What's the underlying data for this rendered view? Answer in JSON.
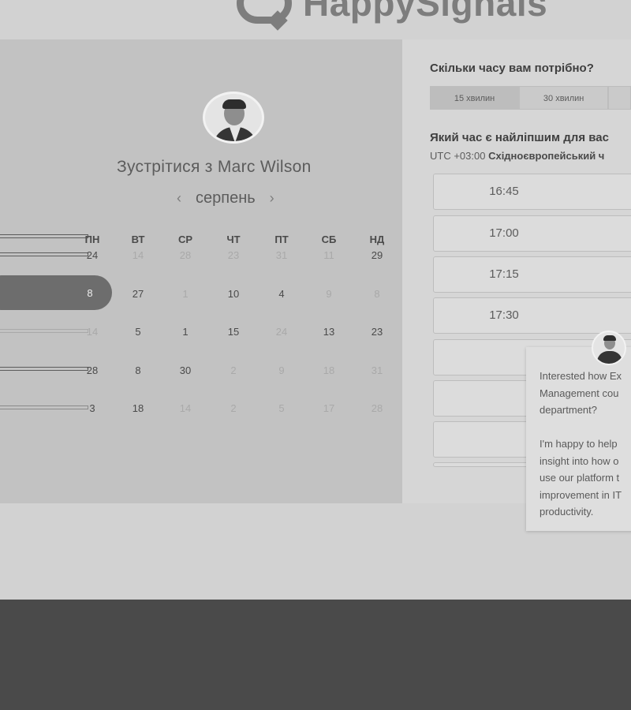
{
  "brand": {
    "logo_text": "HappySignals"
  },
  "calendar": {
    "meet_title": "Зустрітися з Marc Wilson",
    "month": "серпень",
    "prev_arrow": "‹",
    "next_arrow": "›",
    "weekdays": [
      "ПН",
      "ВТ",
      "СР",
      "ЧТ",
      "ПТ",
      "СБ",
      "НД"
    ],
    "rows": [
      [
        "24",
        "14",
        "28",
        "23",
        "31",
        "11",
        "29"
      ],
      [
        "8",
        "27",
        "1",
        "10",
        "4",
        "9",
        "8"
      ],
      [
        "14",
        "5",
        "1",
        "15",
        "24",
        "13",
        "23"
      ],
      [
        "28",
        "8",
        "30",
        "2",
        "9",
        "18",
        "31"
      ],
      [
        "3",
        "18",
        "14",
        "2",
        "5",
        "17",
        "28"
      ]
    ],
    "selected_day": "8"
  },
  "booking": {
    "duration_question": "Скільки часу вам потрібно?",
    "durations": [
      "15 хвилин",
      "30 хвилин"
    ],
    "time_question": "Який час є найліпшим для вас",
    "timezone_offset": "UTC +03:00",
    "timezone_name": "Східноєвропейський ч",
    "slots": [
      "16:45",
      "17:00",
      "17:15",
      "17:30",
      "",
      "",
      ""
    ]
  },
  "chat": {
    "paragraph1": "Interested how Ex\nManagement cou\ndepartment?",
    "paragraph2": "I'm happy to help\ninsight into how o\nuse our platform t\nimprovement in IT\nproductivity."
  }
}
